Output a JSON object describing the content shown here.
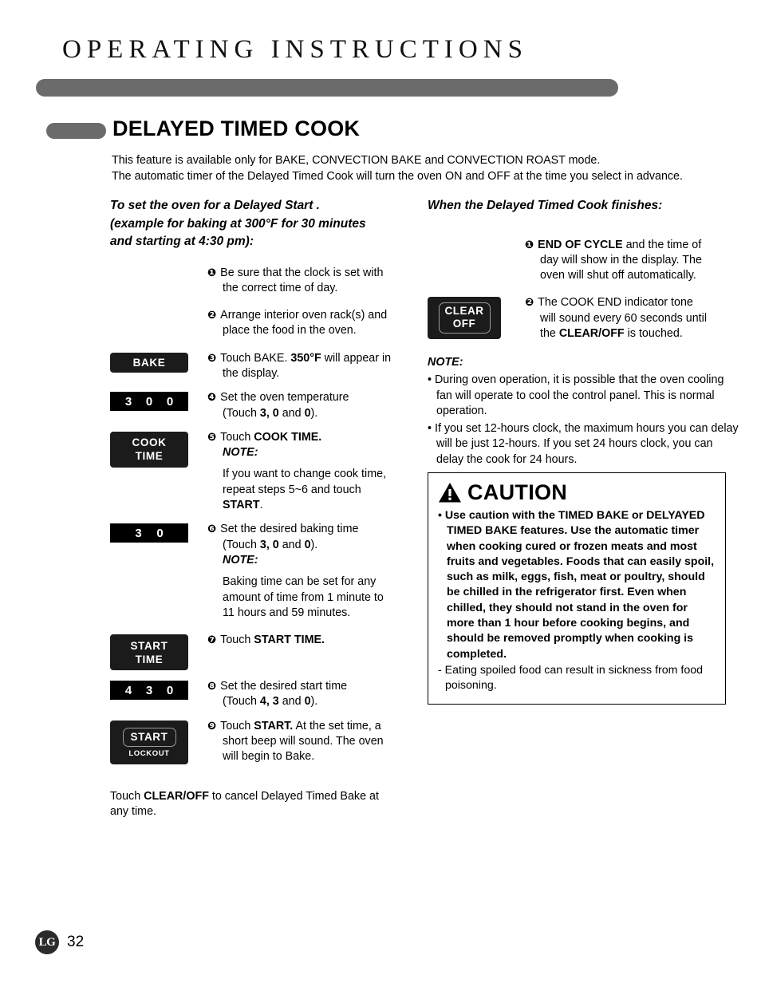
{
  "header": {
    "title": "OPERATING INSTRUCTIONS",
    "bar_color": "#6b6b6b"
  },
  "section": {
    "title": "DELAYED TIMED COOK"
  },
  "intro": {
    "line1": "This feature is available only for BAKE, CONVECTION BAKE and CONVECTION ROAST mode.",
    "line2": "The automatic timer of the Delayed Timed Cook will turn the oven ON and OFF at the time you select in advance."
  },
  "left": {
    "heading_line1": "To set the oven for a Delayed Start .",
    "heading_line2": "(example for baking at 300°F for 30 minutes",
    "heading_line3": "and starting at 4:30 pm):",
    "steps": [
      {
        "num": "❶",
        "line1": "Be sure that the clock is set with",
        "line2": "the correct time of day."
      },
      {
        "num": "❷",
        "line1": "Arrange interior oven rack(s) and",
        "line2": "place the food in the oven."
      },
      {
        "num": "❸",
        "button": "BAKE",
        "pre": "Touch BAKE. ",
        "bold": "350°F",
        "post": " will appear in",
        "line2": "the display."
      },
      {
        "num": "❹",
        "digits": [
          "3",
          "0",
          "0"
        ],
        "line1": "Set the oven temperature",
        "pre2": "(Touch ",
        "b1": "3, 0",
        "mid2": " and ",
        "b2": "0",
        "post2": ")."
      },
      {
        "num": "❺",
        "button_line1": "COOK",
        "button_line2": "TIME",
        "pre": "Touch ",
        "bold": "COOK TIME.",
        "note_label": "NOTE:",
        "note_line1": "If you want to change cook time,",
        "note_line2": "repeat steps 5~6 and touch",
        "note_bold": "START",
        "note_end": "."
      },
      {
        "num": "❻",
        "digits": [
          "3",
          "0"
        ],
        "line1": "Set the desired baking time",
        "pre2": "(Touch ",
        "b1": "3, 0",
        "mid2": " and ",
        "b2": "0",
        "post2": ").",
        "note_label": "NOTE:",
        "note_line1": "Baking time can be set for any",
        "note_line2": "amount of time from 1 minute to",
        "note_line3": "11 hours and 59 minutes."
      },
      {
        "num": "❼",
        "button_line1": "START",
        "button_line2": "TIME",
        "pre": "Touch ",
        "bold": "START TIME."
      },
      {
        "num": "❽",
        "digits": [
          "4",
          "3",
          "0"
        ],
        "line1": "Set the desired start time",
        "pre2": "(Touch ",
        "b1": "4, 3",
        "mid2": " and ",
        "b2": "0",
        "post2": ")."
      },
      {
        "num": "❾",
        "button_main": "START",
        "button_sub": "LOCKOUT",
        "pre": "Touch ",
        "bold": "START.",
        "post": " At the set time, a",
        "line2": "short beep will sound. The oven",
        "line3": "will begin to Bake."
      }
    ],
    "closing_pre": "Touch ",
    "closing_bold": "CLEAR/OFF",
    "closing_post": " to cancel Delayed Timed Bake at",
    "closing_line2": "any time."
  },
  "right": {
    "heading": "When the Delayed Timed Cook finishes:",
    "clear_button_line1": "CLEAR",
    "clear_button_line2": "OFF",
    "steps": [
      {
        "num": "❶",
        "bold": "END OF CYCLE",
        "post": " and the time of",
        "line2": "day will show in the display. The",
        "line3": "oven will shut off automatically."
      },
      {
        "num": "❷",
        "line1": "The COOK END indicator tone",
        "line2": "will sound every 60 seconds until",
        "line3_pre": "the ",
        "line3_bold": "CLEAR/OFF",
        "line3_post": " is touched."
      }
    ],
    "note_label": "NOTE:",
    "notes": [
      "• During oven operation, it is possible that the oven cooling fan will operate to cool the control panel. This is normal operation.",
      "• If you set 12-hours clock, the maximum hours you can delay will be just 12-hours. If you set 24 hours clock, you can delay the cook for 24 hours."
    ]
  },
  "caution": {
    "title": "CAUTION",
    "main": "• Use caution with the TIMED BAKE or DELYAYED TIMED BAKE features. Use the automatic timer when cooking cured or frozen meats and most fruits and vegetables. Foods that can easily spoil, such as milk, eggs, fish, meat or poultry, should be chilled in the refrigerator first. Even when chilled, they should not stand in the oven for more than 1 hour before cooking begins, and should be removed promptly when cooking is completed.",
    "sub": "- Eating spoiled food can result in sickness from food poisoning."
  },
  "footer": {
    "logo": "LG",
    "page": "32"
  }
}
